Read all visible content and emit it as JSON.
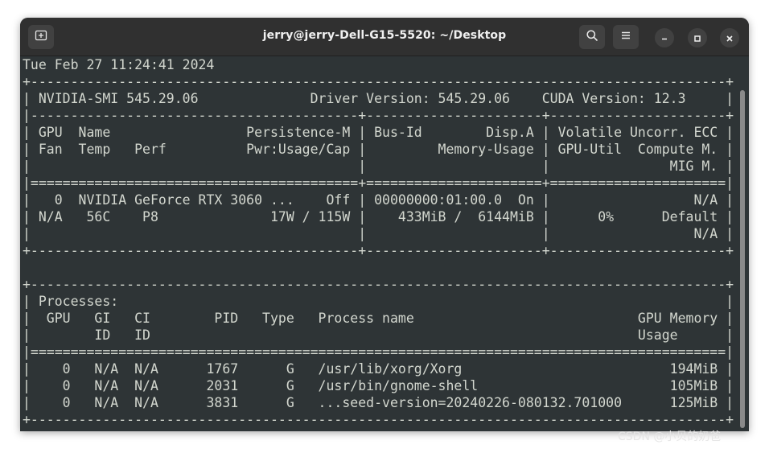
{
  "window": {
    "title": "jerry@jerry-Dell-G15-5520: ~/Desktop",
    "icons": {
      "new_tab": "new-tab-icon",
      "search": "search-icon",
      "menu": "hamburger-menu-icon",
      "minimize": "minimize-icon",
      "maximize": "maximize-icon",
      "close": "close-icon"
    }
  },
  "terminal": {
    "lines": [
      "Tue Feb 27 11:24:41 2024       ",
      "+---------------------------------------------------------------------------------------+",
      "| NVIDIA-SMI 545.29.06              Driver Version: 545.29.06    CUDA Version: 12.3     |",
      "|-----------------------------------------+----------------------+----------------------+",
      "| GPU  Name                 Persistence-M | Bus-Id        Disp.A | Volatile Uncorr. ECC |",
      "| Fan  Temp   Perf          Pwr:Usage/Cap |         Memory-Usage | GPU-Util  Compute M. |",
      "|                                         |                      |               MIG M. |",
      "|=========================================+======================+======================|",
      "|   0  NVIDIA GeForce RTX 3060 ...    Off | 00000000:01:00.0  On |                  N/A |",
      "| N/A   56C    P8              17W / 115W |    433MiB /  6144MiB |      0%      Default |",
      "|                                         |                      |                  N/A |",
      "+-----------------------------------------+----------------------+----------------------+",
      "                                                                                         ",
      "+---------------------------------------------------------------------------------------+",
      "| Processes:                                                                            |",
      "|  GPU   GI   CI        PID   Type   Process name                            GPU Memory |",
      "|        ID   ID                                                             Usage      |",
      "|=======================================================================================|",
      "|    0   N/A  N/A      1767      G   /usr/lib/xorg/Xorg                          194MiB |",
      "|    0   N/A  N/A      2031      G   /usr/bin/gnome-shell                        105MiB |",
      "|    0   N/A  N/A      3831      G   ...seed-version=20240226-080132.701000      125MiB |",
      "+---------------------------------------------------------------------------------------+"
    ]
  },
  "watermark": "CSDN @小贝的奶爸"
}
